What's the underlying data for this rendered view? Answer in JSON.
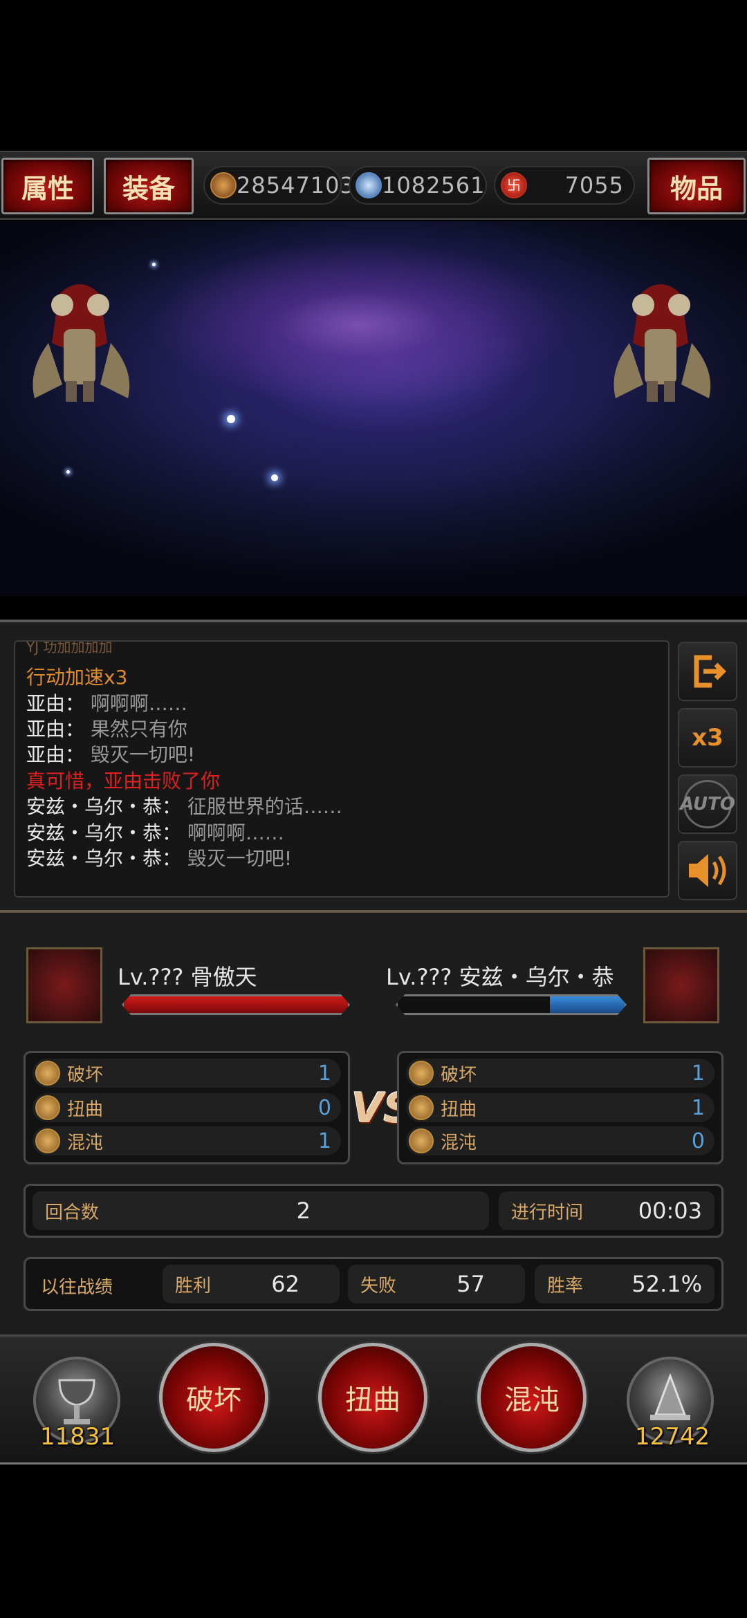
{
  "topbar": {
    "attr_button": "属性",
    "equip_button": "装备",
    "items_button": "物品",
    "resources": [
      {
        "icon": "gold-coin-icon",
        "value": "28547103"
      },
      {
        "icon": "blue-skull-icon",
        "value": "1082561"
      },
      {
        "icon": "red-swastika-icon",
        "value": "7055"
      }
    ]
  },
  "log": {
    "partial_line": "YJ 功加加加加",
    "lines": [
      {
        "speaker": "行动加速x3",
        "message": "",
        "color": "#e08a2a"
      },
      {
        "speaker": "亚由：",
        "message": "啊啊啊……",
        "color": "#e8e8e8"
      },
      {
        "speaker": "亚由：",
        "message": "果然只有你",
        "color": "#e8e8e8"
      },
      {
        "speaker": "亚由：",
        "message": "毁灭一切吧!",
        "color": "#e8e8e8"
      },
      {
        "speaker": "真可惜，亚由击败了你",
        "message": "",
        "color": "#e02020"
      },
      {
        "speaker": "安兹・乌尔・恭：",
        "message": "征服世界的话……",
        "color": "#e8e8e8"
      },
      {
        "speaker": "安兹・乌尔・恭：",
        "message": "啊啊啊……",
        "color": "#e8e8e8"
      },
      {
        "speaker": "安兹・乌尔・恭：",
        "message": "毁灭一切吧!",
        "color": "#e8e8e8"
      }
    ]
  },
  "side_buttons": {
    "exit_icon": "exit-icon",
    "speed_label": "x3",
    "auto_label": "AUTO",
    "sound_icon": "speaker-icon"
  },
  "player": {
    "name": "Lv.??? 骨傲天",
    "hp_fraction": 1.0,
    "stats": [
      {
        "label": "破坏",
        "value": "1"
      },
      {
        "label": "扭曲",
        "value": "0"
      },
      {
        "label": "混沌",
        "value": "1"
      }
    ]
  },
  "opponent": {
    "name": "Lv.??? 安兹・乌尔・恭",
    "hp_fraction": 0.33,
    "stats": [
      {
        "label": "破坏",
        "value": "1"
      },
      {
        "label": "扭曲",
        "value": "1"
      },
      {
        "label": "混沌",
        "value": "0"
      }
    ]
  },
  "vs_label": "VS",
  "round": {
    "label": "回合数",
    "value": "2",
    "time_label": "进行时间",
    "time_value": "00:03"
  },
  "history": {
    "label": "以往战绩",
    "win_label": "胜利",
    "win_value": "62",
    "loss_label": "失败",
    "loss_value": "57",
    "rate_label": "胜率",
    "rate_value": "52.1%"
  },
  "actions": {
    "destroy": "破坏",
    "distort": "扭曲",
    "chaos": "混沌",
    "left_count": "11831",
    "right_count": "12742"
  },
  "colors": {
    "accent_gold": "#d9a968",
    "log_orange": "#e08a2a",
    "defeat_red": "#e02020",
    "stat_blue": "#5aa0d8"
  }
}
